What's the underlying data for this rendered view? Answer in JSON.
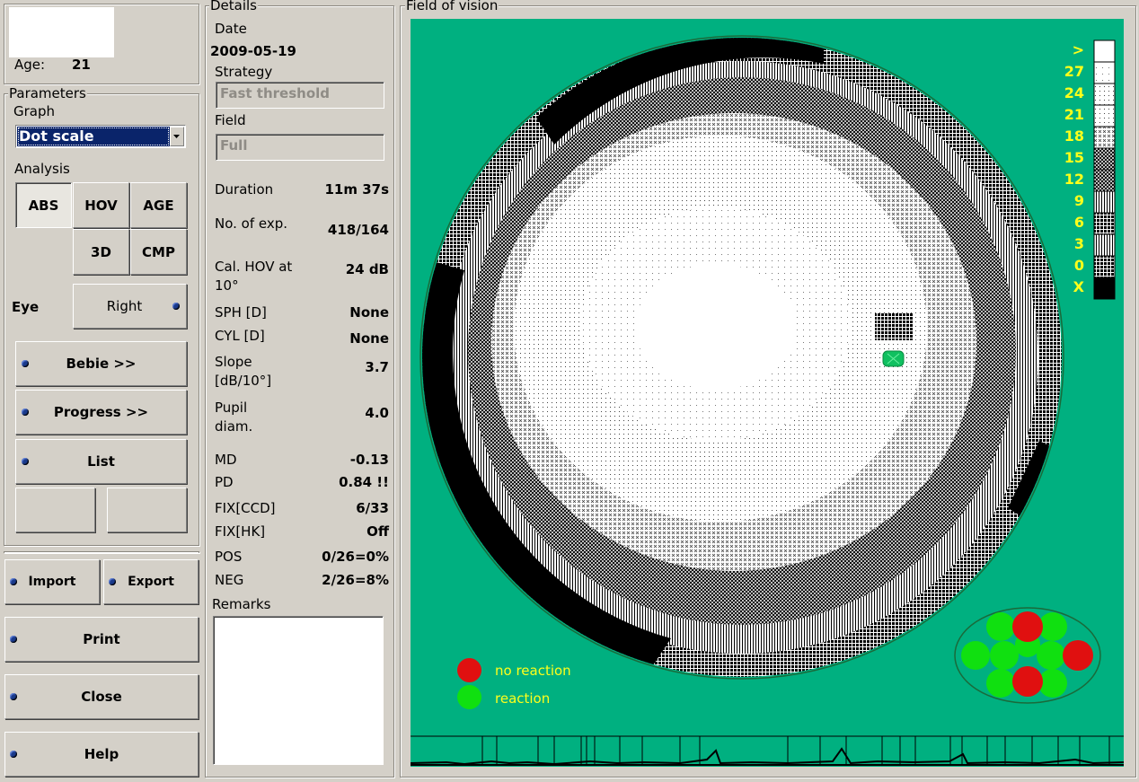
{
  "patient": {
    "age_label": "Age:",
    "age_value": "21"
  },
  "parameters": {
    "group_label": "Parameters",
    "graph_label": "Graph",
    "graph_selected": "Dot scale",
    "analysis_label": "Analysis",
    "analysis_buttons": [
      "ABS",
      "HOV",
      "AGE",
      "3D",
      "CMP"
    ],
    "eye_label": "Eye",
    "eye_value": "Right",
    "bebie": "Bebie >>",
    "progress": "Progress >>",
    "list": "List"
  },
  "actions": {
    "import": "Import",
    "export": "Export",
    "print": "Print",
    "close": "Close",
    "help": "Help"
  },
  "details": {
    "group_label": "Details",
    "date_label": "Date",
    "date_value": "2009-05-19",
    "strategy_label": "Strategy",
    "strategy_value": "Fast threshold",
    "field_label": "Field",
    "field_value": "Full",
    "duration_label": "Duration",
    "duration_value": "11m 37s",
    "exp_label": "No. of exp.",
    "exp_value": "418/164",
    "calhov_label_1": "Cal. HOV at",
    "calhov_label_2": "10°",
    "calhov_value": "24 dB",
    "sph_label": "SPH [D]",
    "sph_value": "None",
    "cyl_label": "CYL [D]",
    "cyl_value": "None",
    "slope_label_1": "Slope",
    "slope_label_2": "[dB/10°]",
    "slope_value": "3.7",
    "pupil_label_1": "Pupil",
    "pupil_label_2": "diam.",
    "pupil_value": "4.0",
    "md_label": "MD",
    "md_value": "-0.13",
    "pd_label": "PD",
    "pd_value": "0.84 !!",
    "fixccd_label": "FIX[CCD]",
    "fixccd_value": "6/33",
    "fixhk_label": "FIX[HK]",
    "fixhk_value": "Off",
    "pos_label": "POS",
    "pos_value": "0/26=0%",
    "neg_label": "NEG",
    "neg_value": "2/26=8%",
    "remarks_label": "Remarks",
    "remarks_value": ""
  },
  "field_of_vision": {
    "group_label": "Field of vision",
    "legend": [
      ">",
      "27",
      "24",
      "21",
      "18",
      "15",
      "12",
      "9",
      "6",
      "3",
      "0",
      "X"
    ],
    "no_reaction": "no reaction",
    "reaction": "reaction",
    "colors": {
      "background": "#00b080",
      "legend_text": "#ffff1a",
      "no_reaction": "#e01010",
      "reaction": "#10e010"
    }
  }
}
